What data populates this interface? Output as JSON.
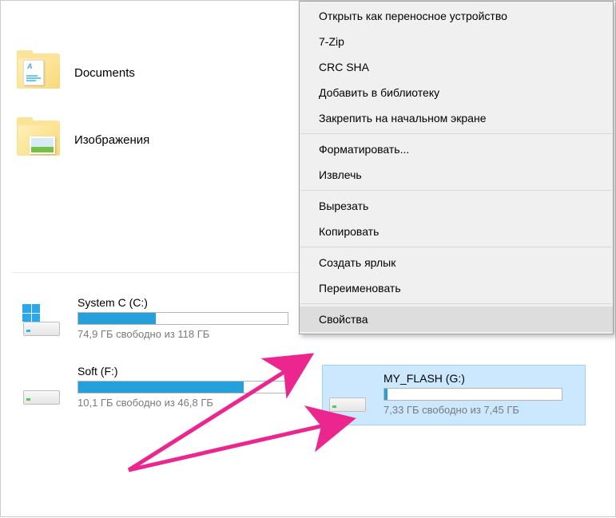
{
  "folders": [
    {
      "label": "Documents",
      "type": "doc"
    },
    {
      "label": "Изображения",
      "type": "img"
    }
  ],
  "drives": {
    "system": {
      "name": "System C (C:)",
      "free": "74,9 ГБ свободно из 118 ГБ",
      "fill_pct": 37
    },
    "soft": {
      "name": "Soft (F:)",
      "free": "10,1 ГБ свободно из 46,8 ГБ",
      "fill_pct": 79
    },
    "flash": {
      "name": "MY_FLASH (G:)",
      "free": "7,33 ГБ свободно из 7,45 ГБ",
      "fill_pct": 2
    }
  },
  "menu": {
    "open_portable": "Открыть как переносное устройство",
    "sevenzip": "7-Zip",
    "crc": "CRC SHA",
    "add_library": "Добавить в библиотеку",
    "pin_start": "Закрепить на начальном экране",
    "format": "Форматировать...",
    "eject": "Извлечь",
    "cut": "Вырезать",
    "copy": "Копировать",
    "shortcut": "Создать ярлык",
    "rename": "Переименовать",
    "properties": "Свойства"
  }
}
